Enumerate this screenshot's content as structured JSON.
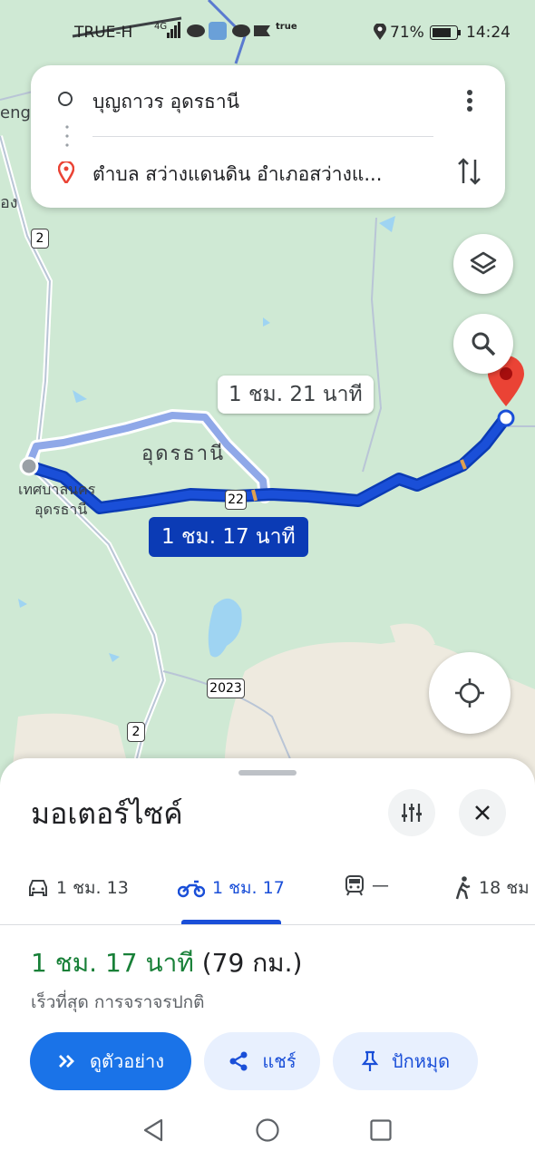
{
  "status_bar": {
    "carrier": "TRUE-H",
    "network": "4G",
    "battery": "71%",
    "time": "14:24"
  },
  "search": {
    "origin": "บุญถาวร อุดรธานี",
    "destination": "ตำบล สว่างแดนดิน อำเภอสว่างแ..."
  },
  "map": {
    "alt_route_label": "1 ชม. 21 นาที",
    "main_route_label": "1 ชม. 17 นาที",
    "city_label": "อุดรธานี",
    "municipality_label_1": "เทศบาลนคร",
    "municipality_label_2": "อุดรธานี",
    "road_22": "22",
    "road_2": "2",
    "road_2023": "2023",
    "edge_label_1": "eng",
    "edge_label_2": "อง"
  },
  "sheet": {
    "title": "มอเตอร์ไซค์",
    "modes": [
      {
        "icon": "car-icon",
        "label": "1 ชม. 13"
      },
      {
        "icon": "motorcycle-icon",
        "label": "1 ชม. 17",
        "selected": true
      },
      {
        "icon": "transit-icon",
        "label": "—"
      },
      {
        "icon": "walk-icon",
        "label": "18 ชม"
      }
    ],
    "duration": "1 ชม. 17 นาที",
    "distance": "(79 กม.)",
    "subtitle": "เร็วที่สุด การจราจรปกติ",
    "preview_label": "ดูตัวอย่าง",
    "share_label": "แชร์",
    "pin_label": "ปักหมุด"
  },
  "colors": {
    "route_main": "#1a4fd8",
    "route_alt": "#8fa8e8",
    "accent_green": "#188038",
    "button_blue": "#1a73e8",
    "pill_bg": "#e8f0fe"
  }
}
